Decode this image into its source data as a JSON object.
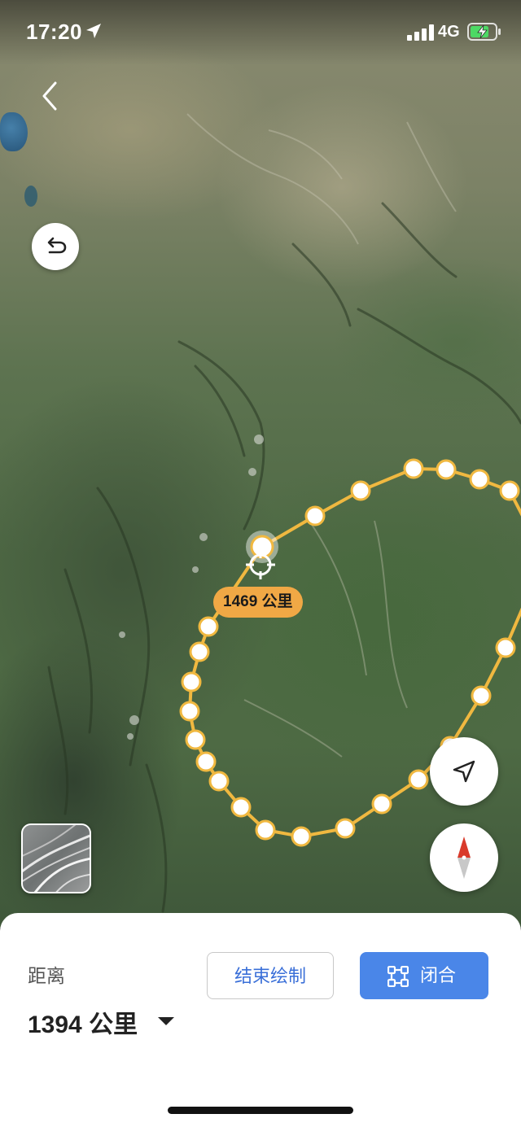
{
  "status_bar": {
    "time": "17:20",
    "network": "4G",
    "icons": [
      "location-arrow-icon",
      "signal-bars-icon",
      "battery-charging-icon"
    ]
  },
  "map": {
    "segment_label": "1469 公里",
    "line_color": "#f0b840",
    "point_fill": "#ffffff",
    "icons": [
      "back-chevron-icon",
      "undo-icon",
      "map-layer-icon",
      "locate-arrow-icon",
      "compass-icon",
      "crosshair-icon"
    ]
  },
  "panel": {
    "distance_label": "距离",
    "distance_value": "1394 公里",
    "end_drawing_label": "结束绘制",
    "close_shape_label": "闭合",
    "accent_color": "#4a86e8"
  }
}
